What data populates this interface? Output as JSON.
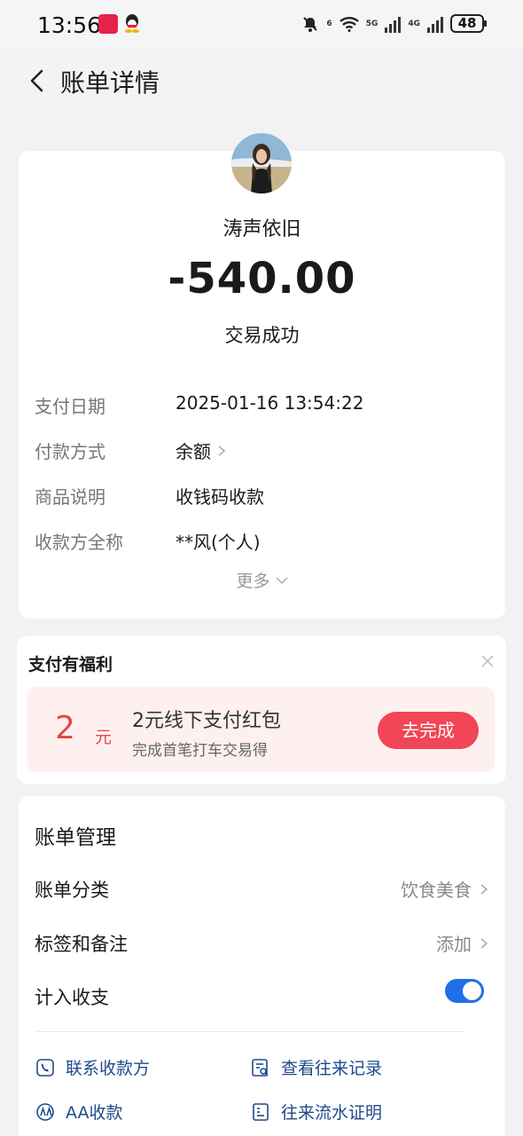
{
  "status_bar": {
    "time": "13:56",
    "battery": "48",
    "net1": "5G",
    "net2": "4G",
    "wifi_tag": "6"
  },
  "nav": {
    "title": "账单详情"
  },
  "bill": {
    "payee": "涛声依旧",
    "amount": "-540.00",
    "status": "交易成功",
    "rows": [
      {
        "label": "支付日期",
        "value": "2025-01-16 13:54:22"
      },
      {
        "label": "付款方式",
        "value": "余额"
      },
      {
        "label": "商品说明",
        "value": "收钱码收款"
      },
      {
        "label": "收款方全称",
        "value": "**风(个人)"
      }
    ],
    "more": "更多"
  },
  "promo": {
    "title": "支付有福利",
    "amount": "2",
    "unit": "元",
    "headline": "2元线下支付红包",
    "sub": "完成首笔打车交易得",
    "button": "去完成"
  },
  "manage": {
    "title": "账单管理",
    "category_label": "账单分类",
    "category_value": "饮食美食",
    "tag_label": "标签和备注",
    "tag_value": "添加",
    "include_label": "计入收支",
    "include_on": true,
    "links": [
      "联系收款方",
      "查看往来记录",
      "AA收款",
      "往来流水证明"
    ]
  },
  "colors": {
    "accent_blue": "#1f6fe8",
    "promo_red": "#f24556",
    "amount_red": "#e8474b"
  }
}
